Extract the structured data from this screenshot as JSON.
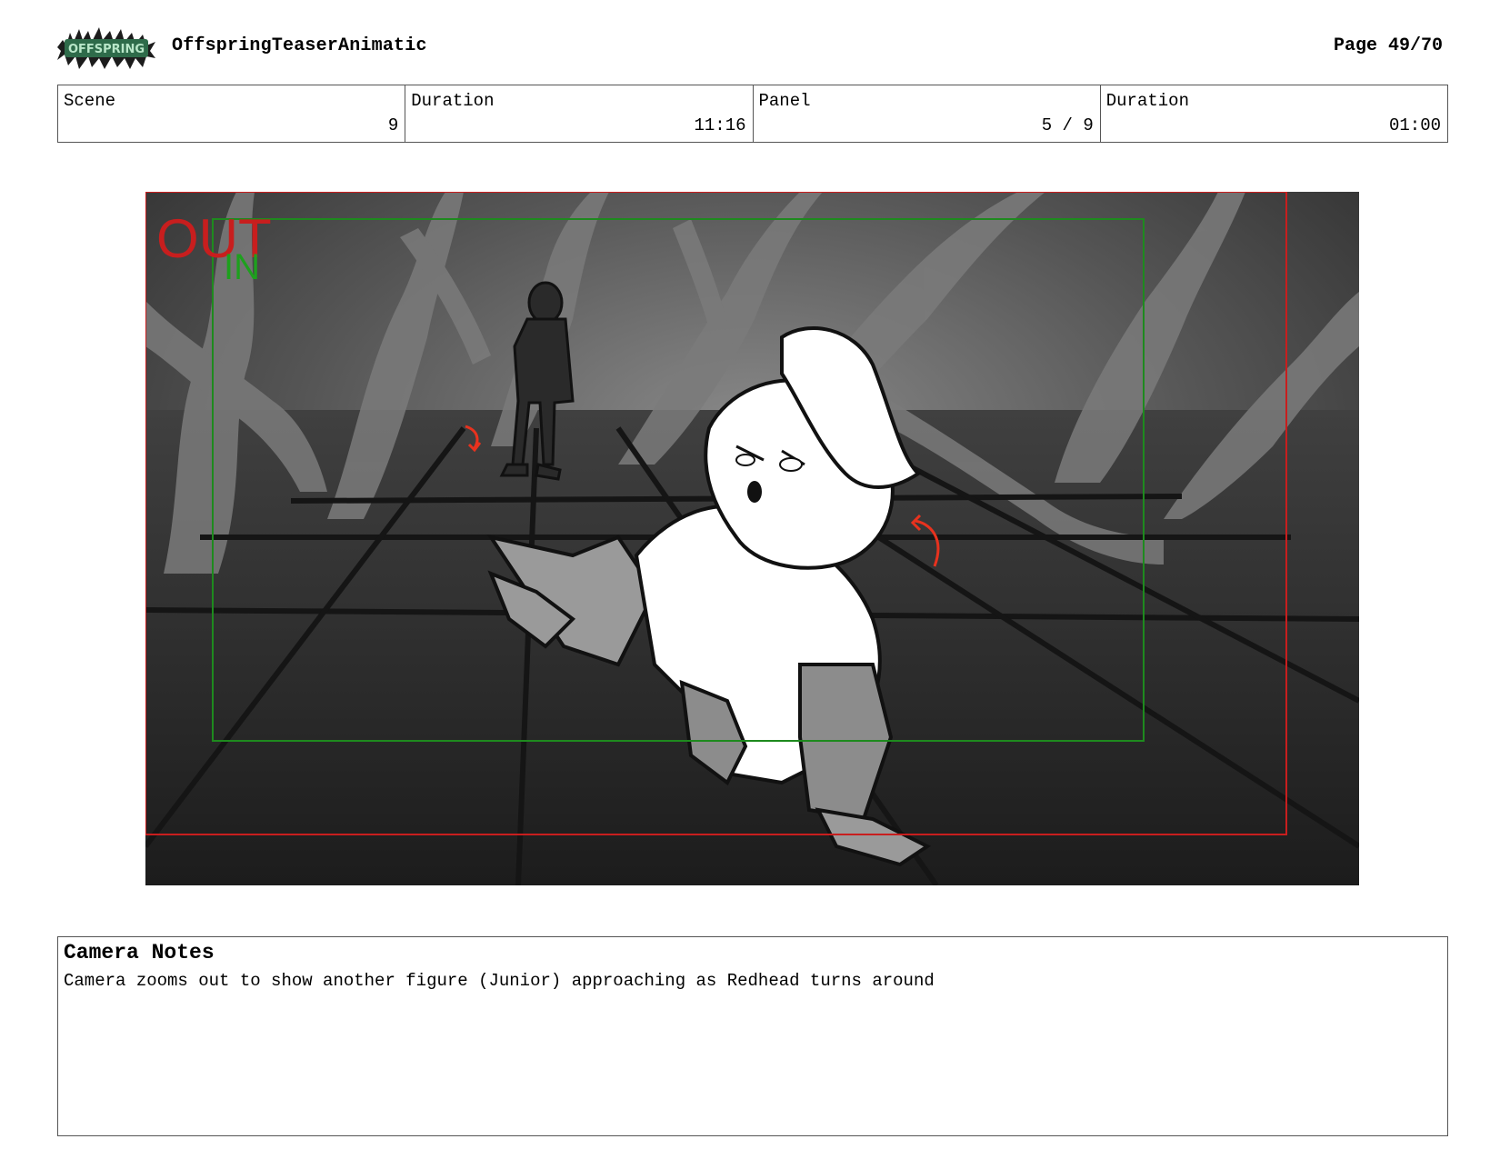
{
  "header": {
    "logo_text": "OFFSPRING",
    "project_title": "OffspringTeaserAnimatic",
    "page_label": "Page 49/70"
  },
  "info": {
    "scene_label": "Scene",
    "scene_value": "9",
    "duration_label": "Duration",
    "duration_value": "11:16",
    "panel_label": "Panel",
    "panel_value": "5 / 9",
    "panel_duration_label": "Duration",
    "panel_duration_value": "01:00"
  },
  "panel": {
    "out_marker": "OUT",
    "in_marker": "IN",
    "colors": {
      "out_frame": "#c81e1e",
      "in_frame": "#1e8a1e",
      "action_arrow": "#e8321e"
    }
  },
  "notes": {
    "title": "Camera Notes",
    "text": "Camera zooms out to show another figure (Junior) approaching as Redhead turns around"
  }
}
